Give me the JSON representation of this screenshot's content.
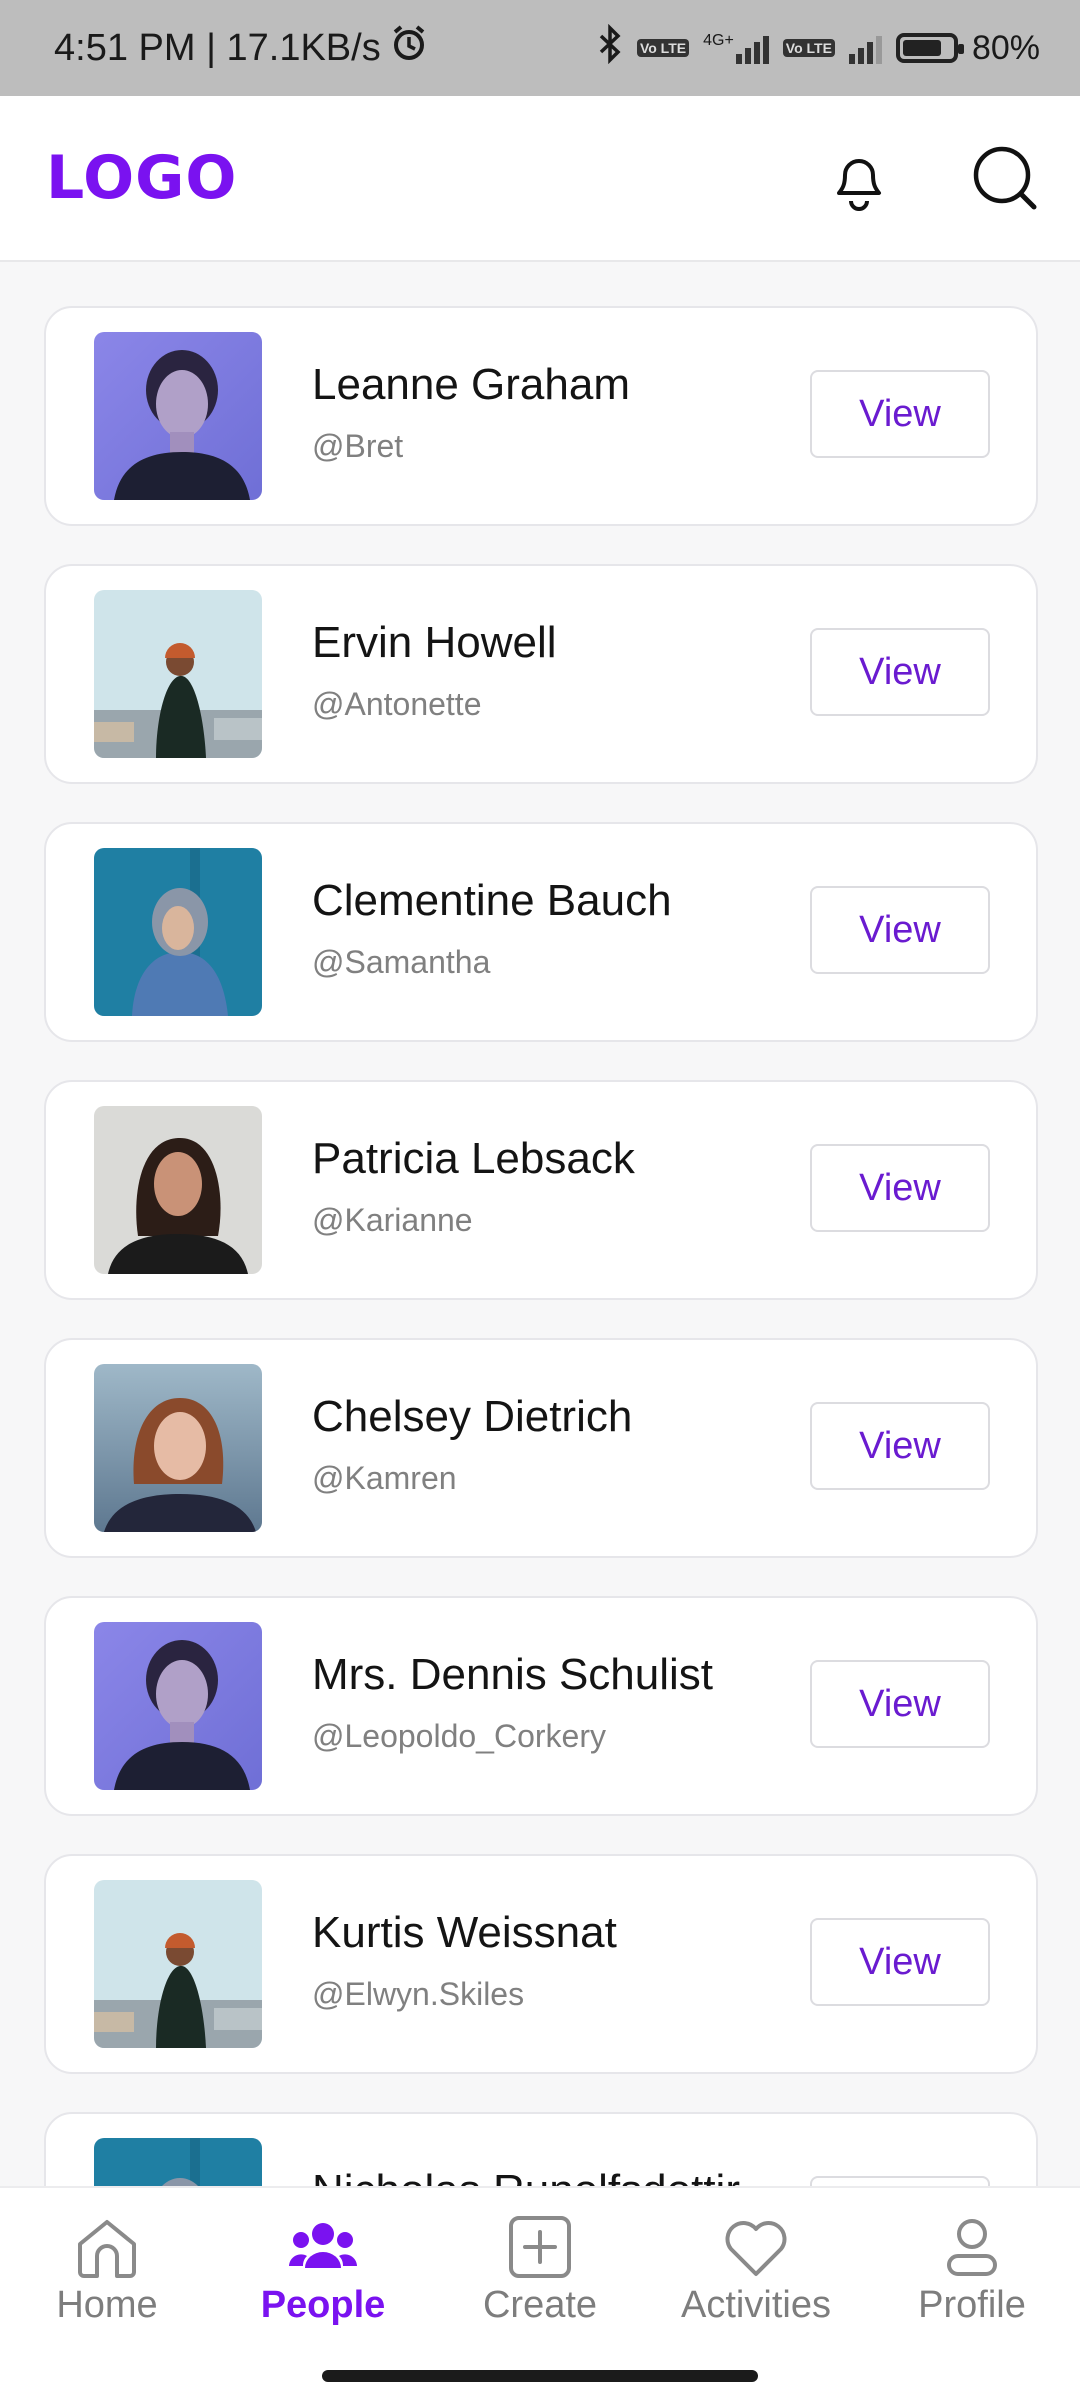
{
  "status_bar": {
    "time_speed": "4:51 PM | 17.1KB/s",
    "network_1": "4G+",
    "volte_1": "Vo LTE",
    "volte_2": "Vo LTE",
    "battery": "80%",
    "battery_level": 0.8,
    "icons": [
      "alarm-icon",
      "bluetooth-icon",
      "signal-icon",
      "battery-icon"
    ]
  },
  "header": {
    "logo": "LOGO",
    "icons": [
      "bell-icon",
      "search-icon"
    ]
  },
  "colors": {
    "accent": "#7a12f0",
    "view_text": "#6a1bd0",
    "inactive": "#7d7d7d"
  },
  "people": [
    {
      "name": "Leanne Graham",
      "handle": "@Bret",
      "action": "View",
      "avatar": "portrait-purple"
    },
    {
      "name": "Ervin Howell",
      "handle": "@Antonette",
      "action": "View",
      "avatar": "man-beanie"
    },
    {
      "name": "Clementine Bauch",
      "handle": "@Samantha",
      "action": "View",
      "avatar": "hoodie-blue"
    },
    {
      "name": "Patricia Lebsack",
      "handle": "@Karianne",
      "action": "View",
      "avatar": "woman-smile"
    },
    {
      "name": "Chelsey Dietrich",
      "handle": "@Kamren",
      "action": "View",
      "avatar": "woman-bob"
    },
    {
      "name": "Mrs. Dennis Schulist",
      "handle": "@Leopoldo_Corkery",
      "action": "View",
      "avatar": "portrait-purple"
    },
    {
      "name": "Kurtis Weissnat",
      "handle": "@Elwyn.Skiles",
      "action": "View",
      "avatar": "man-beanie"
    },
    {
      "name": "Nicholas Runolfsdottir",
      "handle": "",
      "action": "View",
      "avatar": "hoodie-blue"
    }
  ],
  "bottom_nav": [
    {
      "label": "Home",
      "icon": "home-icon",
      "active": false
    },
    {
      "label": "People",
      "icon": "people-icon",
      "active": true
    },
    {
      "label": "Create",
      "icon": "plus-square-icon",
      "active": false
    },
    {
      "label": "Activities",
      "icon": "heart-icon",
      "active": false
    },
    {
      "label": "Profile",
      "icon": "user-icon",
      "active": false
    }
  ]
}
